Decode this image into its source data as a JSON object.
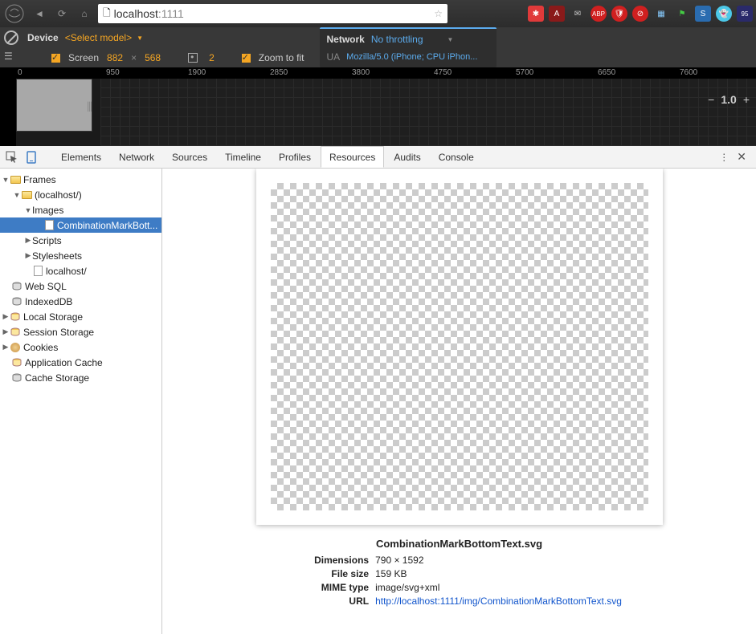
{
  "browser": {
    "url_host": "localhost",
    "url_port": ":1111"
  },
  "device_toolbar": {
    "device_label": "Device",
    "device_select": "<Select model>",
    "screen_label": "Screen",
    "width": "882",
    "x": "×",
    "height": "568",
    "dpr": "2",
    "zoom_label": "Zoom to fit",
    "network_label": "Network",
    "network_value": "No throttling",
    "ua_label": "UA",
    "ua_value": "Mozilla/5.0 (iPhone; CPU iPhon..."
  },
  "ruler": [
    "0",
    "950",
    "1900",
    "2850",
    "3800",
    "4750",
    "5700",
    "6650",
    "7600"
  ],
  "zoom": {
    "minus": "−",
    "value": "1.0",
    "plus": "+"
  },
  "tabs": [
    "Elements",
    "Network",
    "Sources",
    "Timeline",
    "Profiles",
    "Resources",
    "Audits",
    "Console"
  ],
  "tabs_active": "Resources",
  "tree": {
    "frames": "Frames",
    "localhost": "(localhost/)",
    "images": "Images",
    "selected_file": "CombinationMarkBott...",
    "scripts": "Scripts",
    "stylesheets": "Stylesheets",
    "localhost_file": "localhost/",
    "websql": "Web SQL",
    "indexeddb": "IndexedDB",
    "localstorage": "Local Storage",
    "sessionstorage": "Session Storage",
    "cookies": "Cookies",
    "appcache": "Application Cache",
    "cachestorage": "Cache Storage"
  },
  "preview": {
    "filename": "CombinationMarkBottomText.svg",
    "dimensions_label": "Dimensions",
    "dimensions_value": "790 × 1592",
    "filesize_label": "File size",
    "filesize_value": "159 KB",
    "mime_label": "MIME type",
    "mime_value": "image/svg+xml",
    "url_label": "URL",
    "url_value": "http://localhost:1111/img/CombinationMarkBottomText.svg"
  }
}
